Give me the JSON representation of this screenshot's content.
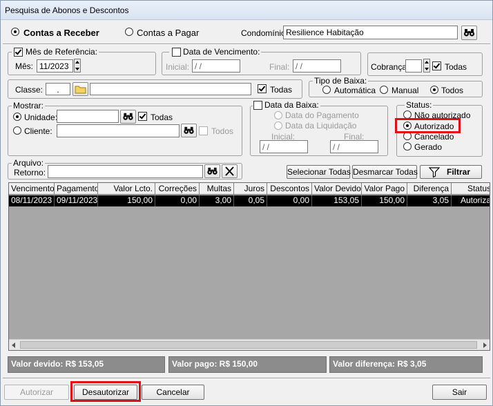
{
  "window": {
    "title": "Pesquisa de Abonos e Descontos"
  },
  "tipo": {
    "receber": "Contas a Receber",
    "pagar": "Contas a Pagar"
  },
  "condominio": {
    "label": "Condomínio:",
    "value": "Resilience Habitação"
  },
  "mes_ref": {
    "legend": "Mês de Referência:",
    "label": "Mês:",
    "value": "11/2023"
  },
  "vencimento": {
    "legend": "Data de Vencimento:",
    "inicial_label": "Inicial:",
    "inicial_value": " / /",
    "final_label": "Final:",
    "final_value": " / /"
  },
  "cobranca": {
    "label": "Cobrança:",
    "value": "",
    "todas_label": "Todas"
  },
  "classe": {
    "label": "Classe:",
    "value": ".",
    "desc": "",
    "todas_label": "Todas"
  },
  "tipo_baixa": {
    "legend": "Tipo de Baixa:",
    "automatica": "Automática",
    "manual": "Manual",
    "todos": "Todos"
  },
  "mostrar": {
    "legend": "Mostrar:",
    "unidade_label": "Unidade:",
    "unidade_value": "",
    "todas_label": "Todas",
    "cliente_label": "Cliente:",
    "cliente_value": "",
    "todos_label": "Todos"
  },
  "data_baixa": {
    "legend": "Data da Baixa:",
    "pagamento": "Data do Pagamento",
    "liquidacao": "Data da Liquidação",
    "inicial_label": "Inicial:",
    "inicial_value": " / /",
    "final_label": "Final:",
    "final_value": " / /"
  },
  "status": {
    "legend": "Status:",
    "nao_autorizado": "Não autorizado",
    "autorizado": "Autorizado",
    "cancelado": "Cancelado",
    "gerado": "Gerado"
  },
  "arquivo": {
    "legend": "Arquivo:",
    "retorno_label": "Retorno:",
    "retorno_value": ""
  },
  "actions": {
    "selecionar": "Selecionar Todas",
    "desmarcar": "Desmarcar Todas",
    "filtrar": "Filtrar"
  },
  "table": {
    "columns": [
      "Vencimento",
      "Pagamento",
      "Valor Lcto.",
      "Correções",
      "Multas",
      "Juros",
      "Descontos",
      "Valor Devido",
      "Valor Pago",
      "Diferença",
      "Status"
    ],
    "rows": [
      [
        "08/11/2023",
        "09/11/2023",
        "150,00",
        "0,00",
        "3,00",
        "0,05",
        "0,00",
        "153,05",
        "150,00",
        "3,05",
        "Autoriza"
      ]
    ]
  },
  "summary": {
    "devido": "Valor devido: R$ 153,05",
    "pago": "Valor pago: R$ 150,00",
    "diferenca": "Valor diferença: R$ 3,05"
  },
  "footer": {
    "autorizar": "Autorizar",
    "desautorizar": "Desautorizar",
    "cancelar": "Cancelar",
    "sair": "Sair"
  },
  "colors": {
    "highlight": "#e01010",
    "selected_row_bg": "#000000",
    "grid_bg": "#a7a7a7",
    "summary_bg": "#8c8c8c"
  }
}
